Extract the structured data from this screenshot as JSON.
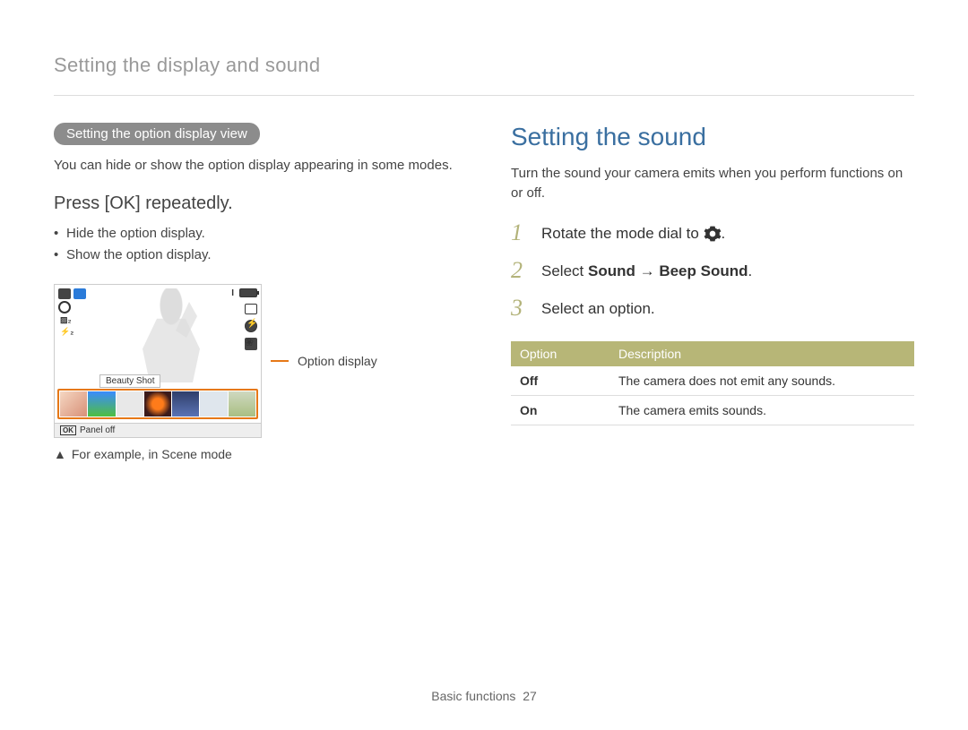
{
  "page_header": "Setting the display and sound",
  "left": {
    "pill": "Setting the option display view",
    "intro": "You can hide or show the option display appearing in some modes.",
    "instruction_prefix": "Press [",
    "instruction_ok": "OK",
    "instruction_suffix": "] repeatedly.",
    "bullets": [
      "Hide the option display.",
      "Show the option display."
    ],
    "screenshot": {
      "beauty_label": "Beauty Shot",
      "panel_off_key": "OK",
      "panel_off_text": "Panel off"
    },
    "callout": "Option display",
    "caption_triangle": "▲",
    "caption": "For example, in Scene mode"
  },
  "right": {
    "heading": "Setting the sound",
    "intro": "Turn the sound your camera emits when you perform functions on or off.",
    "steps": [
      {
        "text_prefix": "Rotate the mode dial to ",
        "icon": "gear",
        "text_suffix": "."
      },
      {
        "text_prefix": "Select ",
        "bold1": "Sound",
        "arrow": " → ",
        "bold2": "Beep Sound",
        "text_suffix": "."
      },
      {
        "text_prefix": "Select an option."
      }
    ],
    "table": {
      "headers": [
        "Option",
        "Description"
      ],
      "rows": [
        {
          "option": "Off",
          "desc": "The camera does not emit any sounds."
        },
        {
          "option": "On",
          "desc": "The camera emits sounds."
        }
      ]
    }
  },
  "footer": {
    "section": "Basic functions",
    "page": "27"
  }
}
